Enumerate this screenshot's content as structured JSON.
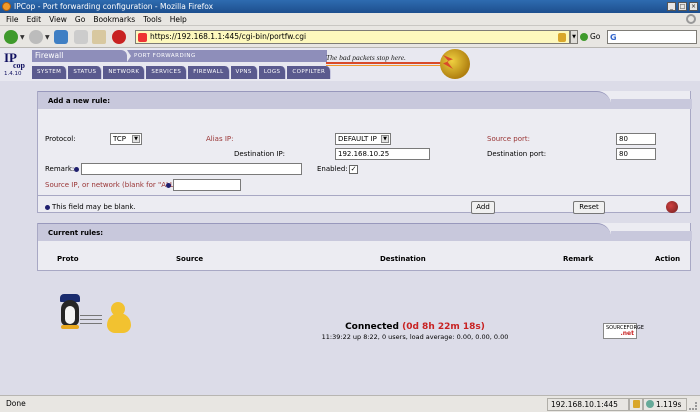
{
  "window": {
    "title": "IPCop - Port forwarding configuration - Mozilla Firefox"
  },
  "menu": [
    "File",
    "Edit",
    "View",
    "Go",
    "Bookmarks",
    "Tools",
    "Help"
  ],
  "toolbar": {
    "url": "https://192.168.1.1:445/cgi-bin/portfw.cgi",
    "go_label": "Go",
    "search_icon_letter": "G"
  },
  "header": {
    "logo_ip": "IP",
    "logo_cop": "cop",
    "logo_version": "1.4.10",
    "section": "Firewall",
    "page": "Port Forwarding",
    "slogan": "The bad packets stop here.",
    "tabs": [
      "System",
      "Status",
      "Network",
      "Services",
      "Firewall",
      "VPNs",
      "Logs",
      "Copfilter"
    ]
  },
  "add_rule": {
    "title": "Add a new rule:",
    "protocol_label": "Protocol:",
    "protocol_value": "TCP",
    "alias_ip_label": "Alias IP:",
    "alias_ip_value": "DEFAULT IP",
    "source_port_label": "Source port:",
    "source_port_value": "80",
    "destination_ip_label": "Destination IP:",
    "destination_ip_value": "192.168.10.25",
    "destination_port_label": "Destination port:",
    "destination_port_value": "80",
    "remark_label": "Remark:",
    "remark_value": "",
    "enabled_label": "Enabled:",
    "enabled_checked": true,
    "source_ip_label": "Source IP, or network (blank for \"ALL\"):",
    "source_ip_value": "",
    "note": "This field may be blank.",
    "add_button": "Add",
    "reset_button": "Reset"
  },
  "current_rules": {
    "title": "Current rules:",
    "columns": [
      "Proto",
      "Source",
      "Destination",
      "Remark",
      "Action"
    ]
  },
  "footer": {
    "connected_label": "Connected",
    "connected_time": "(0d 8h 22m 18s)",
    "uptime_line": "11:39:22 up 8:22, 0 users, load average: 0.00, 0.00, 0.00",
    "sf_text": "SOURCEFORGE",
    "sf_net": ".net"
  },
  "statusbar": {
    "status": "Done",
    "ip": "192.168.10.1:445",
    "timer": "1.119s"
  },
  "colors": {
    "title_bar": "#2e6bb0",
    "tab": "#5a5a8e",
    "section_bar": "#8e8eba",
    "red_label": "#993333",
    "connected_time": "#c82222",
    "url_bg": "#fdf8bd"
  }
}
